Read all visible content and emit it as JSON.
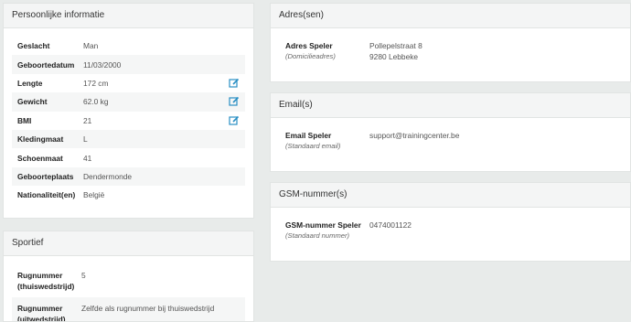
{
  "personal": {
    "title": "Persoonlijke informatie",
    "rows": [
      {
        "label": "Geslacht",
        "value": "Man",
        "editable": false
      },
      {
        "label": "Geboortedatum",
        "value": "11/03/2000",
        "editable": false
      },
      {
        "label": "Lengte",
        "value": "172 cm",
        "editable": true
      },
      {
        "label": "Gewicht",
        "value": "62.0 kg",
        "editable": true
      },
      {
        "label": "BMI",
        "value": "21",
        "editable": true
      },
      {
        "label": "Kledingmaat",
        "value": "L",
        "editable": false
      },
      {
        "label": "Schoenmaat",
        "value": "41",
        "editable": false
      },
      {
        "label": "Geboorteplaats",
        "value": "Dendermonde",
        "editable": false
      },
      {
        "label": "Nationaliteit(en)",
        "value": "België",
        "editable": false
      }
    ]
  },
  "sportief": {
    "title": "Sportief",
    "rows": [
      {
        "label": "Rugnummer (thuiswedstrijd)",
        "value": "5"
      },
      {
        "label": "Rugnummer (uitwedstrijd)",
        "value": "Zelfde als rugnummer bij thuiswedstrijd"
      }
    ]
  },
  "address": {
    "title": "Adres(sen)",
    "label": "Adres Speler",
    "sublabel": "(Domicilieadres)",
    "line1": "Pollepelstraat 8",
    "line2": "9280 Lebbeke"
  },
  "email": {
    "title": "Email(s)",
    "label": "Email Speler",
    "sublabel": "(Standaard email)",
    "value": "support@trainingcenter.be"
  },
  "gsm": {
    "title": "GSM-nummer(s)",
    "label": "GSM-nummer Speler",
    "sublabel": "(Standaard nummer)",
    "value": "0474001122"
  },
  "colors": {
    "link": "#1b9ad6",
    "edit_icon": "#2a8fc4"
  },
  "icons": {
    "edit": "edit-icon"
  }
}
